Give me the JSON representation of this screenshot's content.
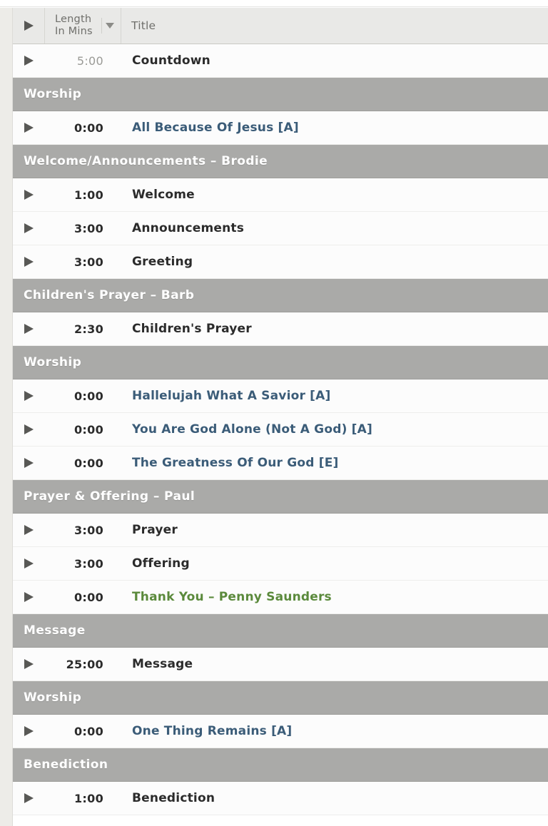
{
  "header": {
    "play_column": "",
    "length_label_line1": "Length",
    "length_label_line2": "In Mins",
    "title_label": "Title",
    "sort_caret": "chevron-down-icon"
  },
  "colors": {
    "section_bar": "#aaaaa8",
    "song_title": "#3b5c78",
    "note_title": "#5b8a3c",
    "item_title": "#2b2b2b",
    "row_background": "#fcfcfc",
    "header_background": "#e9e9e7",
    "gutter": "#edece8"
  },
  "rows": [
    {
      "kind": "item",
      "length": "5:00",
      "title": "Countdown",
      "style": "plain",
      "length_style": "muted"
    },
    {
      "kind": "section",
      "title": "Worship"
    },
    {
      "kind": "item",
      "length": "0:00",
      "title": "All Because Of Jesus [A]",
      "style": "song",
      "length_style": "normal"
    },
    {
      "kind": "section",
      "title": "Welcome/Announcements – Brodie"
    },
    {
      "kind": "item",
      "length": "1:00",
      "title": "Welcome",
      "style": "plain",
      "length_style": "normal"
    },
    {
      "kind": "item",
      "length": "3:00",
      "title": "Announcements",
      "style": "plain",
      "length_style": "normal"
    },
    {
      "kind": "item",
      "length": "3:00",
      "title": "Greeting",
      "style": "plain",
      "length_style": "normal"
    },
    {
      "kind": "section",
      "title": "Children's Prayer – Barb"
    },
    {
      "kind": "item",
      "length": "2:30",
      "title": "Children's Prayer",
      "style": "plain",
      "length_style": "normal"
    },
    {
      "kind": "section",
      "title": "Worship"
    },
    {
      "kind": "item",
      "length": "0:00",
      "title": "Hallelujah What A Savior [A]",
      "style": "song",
      "length_style": "normal"
    },
    {
      "kind": "item",
      "length": "0:00",
      "title": "You Are God Alone (Not A God) [A]",
      "style": "song",
      "length_style": "normal"
    },
    {
      "kind": "item",
      "length": "0:00",
      "title": "The Greatness Of Our God [E]",
      "style": "song",
      "length_style": "normal"
    },
    {
      "kind": "section",
      "title": "Prayer & Offering – Paul"
    },
    {
      "kind": "item",
      "length": "3:00",
      "title": "Prayer",
      "style": "plain",
      "length_style": "normal"
    },
    {
      "kind": "item",
      "length": "3:00",
      "title": "Offering",
      "style": "plain",
      "length_style": "normal"
    },
    {
      "kind": "item",
      "length": "0:00",
      "title": "Thank You – Penny Saunders",
      "style": "note",
      "length_style": "normal"
    },
    {
      "kind": "section",
      "title": "Message"
    },
    {
      "kind": "item",
      "length": "25:00",
      "title": "Message",
      "style": "plain",
      "length_style": "normal"
    },
    {
      "kind": "section",
      "title": "Worship"
    },
    {
      "kind": "item",
      "length": "0:00",
      "title": "One Thing Remains [A]",
      "style": "song",
      "length_style": "normal"
    },
    {
      "kind": "section",
      "title": "Benediction"
    },
    {
      "kind": "item",
      "length": "1:00",
      "title": "Benediction",
      "style": "plain",
      "length_style": "normal"
    }
  ]
}
